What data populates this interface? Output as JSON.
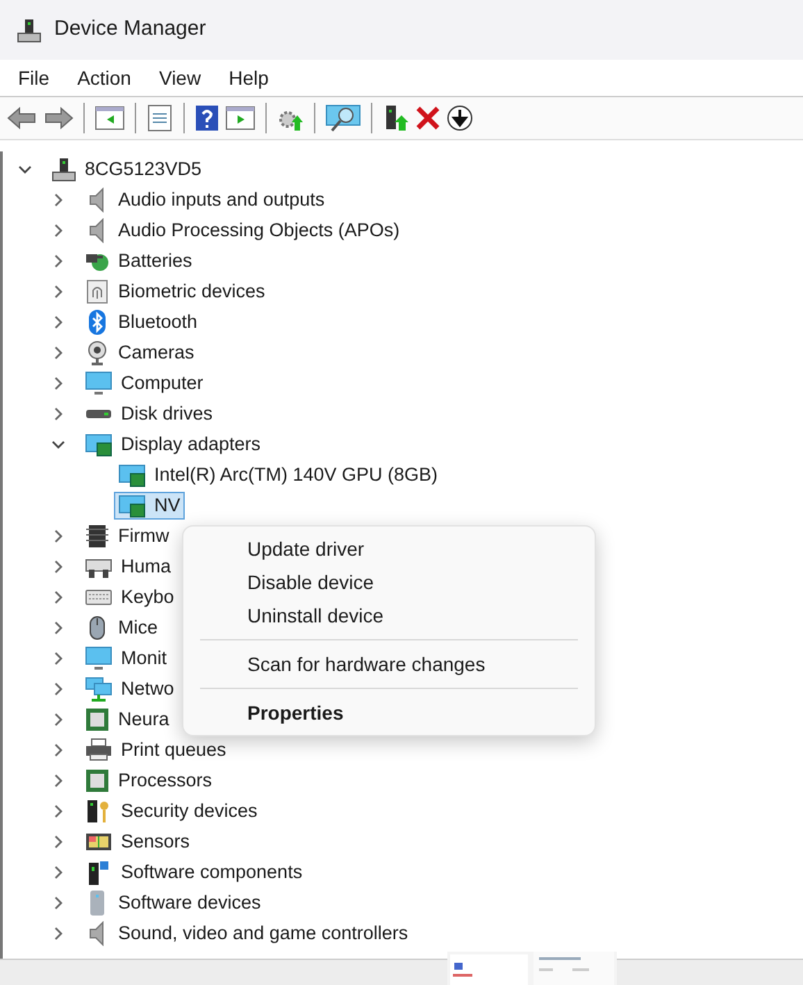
{
  "window": {
    "title": "Device Manager"
  },
  "menu_bar": [
    "File",
    "Action",
    "View",
    "Help"
  ],
  "tree": {
    "label": "8CG5123VD5",
    "expanded": true,
    "selected": false,
    "children": [
      {
        "label": "Audio inputs and outputs",
        "expanded": false,
        "selected": false
      },
      {
        "label": "Audio Processing Objects (APOs)",
        "expanded": false,
        "selected": false
      },
      {
        "label": "Batteries",
        "expanded": false,
        "selected": false
      },
      {
        "label": "Biometric devices",
        "expanded": false,
        "selected": false
      },
      {
        "label": "Bluetooth",
        "expanded": false,
        "selected": false
      },
      {
        "label": "Cameras",
        "expanded": false,
        "selected": false
      },
      {
        "label": "Computer",
        "expanded": false,
        "selected": false
      },
      {
        "label": "Disk drives",
        "expanded": false,
        "selected": false
      },
      {
        "label": "Display adapters",
        "expanded": true,
        "selected": false,
        "children": [
          {
            "label": "Intel(R) Arc(TM) 140V GPU (8GB)",
            "selected": false
          },
          {
            "label": "NV",
            "selected": true
          }
        ]
      },
      {
        "label": "Firmw",
        "expanded": false,
        "selected": false
      },
      {
        "label": "Huma",
        "expanded": false,
        "selected": false
      },
      {
        "label": "Keybo",
        "expanded": false,
        "selected": false
      },
      {
        "label": "Mice",
        "expanded": false,
        "selected": false
      },
      {
        "label": "Monit",
        "expanded": false,
        "selected": false
      },
      {
        "label": "Netwo",
        "expanded": false,
        "selected": false
      },
      {
        "label": "Neura",
        "expanded": false,
        "selected": false
      },
      {
        "label": "Print queues",
        "expanded": false,
        "selected": false
      },
      {
        "label": "Processors",
        "expanded": false,
        "selected": false
      },
      {
        "label": "Security devices",
        "expanded": false,
        "selected": false
      },
      {
        "label": "Sensors",
        "expanded": false,
        "selected": false
      },
      {
        "label": "Software components",
        "expanded": false,
        "selected": false
      },
      {
        "label": "Software devices",
        "expanded": false,
        "selected": false
      },
      {
        "label": "Sound, video and game controllers",
        "expanded": false,
        "selected": false
      }
    ]
  },
  "context_menu": [
    {
      "kind": "item",
      "label": "Update driver",
      "default": false
    },
    {
      "kind": "item",
      "label": "Disable device",
      "default": false
    },
    {
      "kind": "item",
      "label": "Uninstall device",
      "default": false
    },
    {
      "kind": "separator"
    },
    {
      "kind": "item",
      "label": "Scan for hardware changes",
      "default": false
    },
    {
      "kind": "separator"
    },
    {
      "kind": "item",
      "label": "Properties",
      "default": true
    }
  ]
}
